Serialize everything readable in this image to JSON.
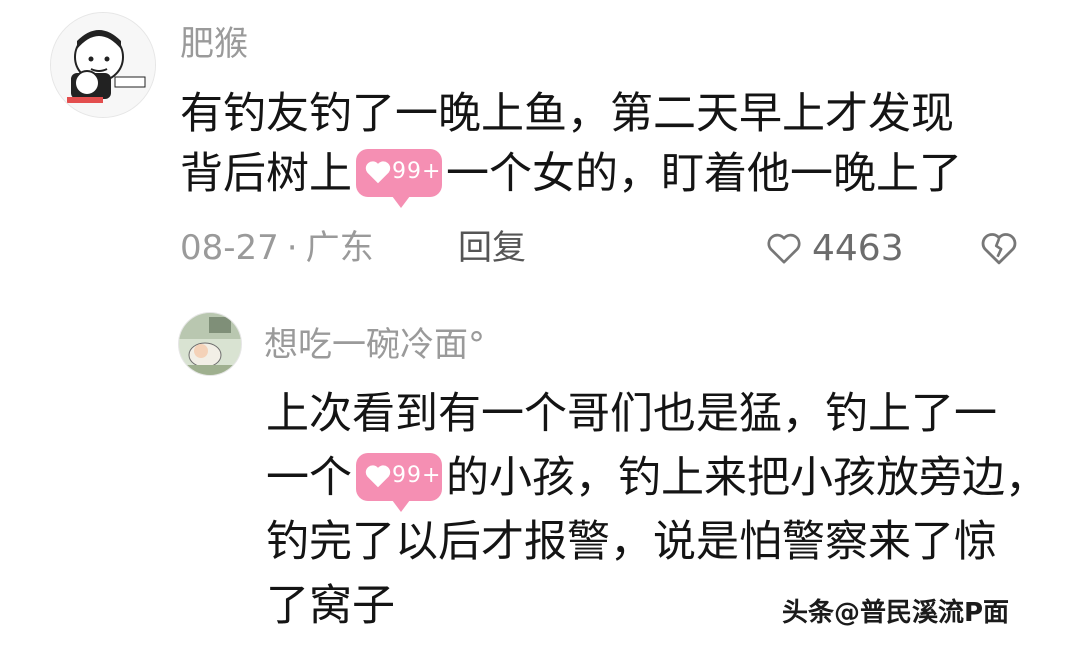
{
  "comment": {
    "username": "肥猴",
    "lines": [
      {
        "before": "有钓友钓了一晚上鱼，第二天早上才发现",
        "after": ""
      },
      {
        "before": "背后树上",
        "badge": "99+",
        "after": "一个女的，盯着他一晚上了"
      }
    ],
    "date": "08-27",
    "separator": "·",
    "location": "广东",
    "reply_label": "回复",
    "likes": "4463",
    "icons": {
      "like": "heart-outline-icon",
      "dislike": "broken-heart-icon"
    }
  },
  "reply": {
    "username": "想吃一碗冷面°",
    "lines": [
      {
        "before": "上次看到有一个哥们也是猛，钓上了一",
        "after": ""
      },
      {
        "before": "一个",
        "badge": "99+",
        "after": "的小孩，钓上来把小孩放旁边，"
      },
      {
        "before": "钓完了以后才报警，说是怕警察来了惊",
        "after": ""
      },
      {
        "before": "了窝子",
        "after": ""
      }
    ]
  },
  "watermark": "头条@普民溪流P面",
  "colors": {
    "badge": "#f58fb3",
    "meta": "#9a9a9a",
    "text": "#141414"
  }
}
